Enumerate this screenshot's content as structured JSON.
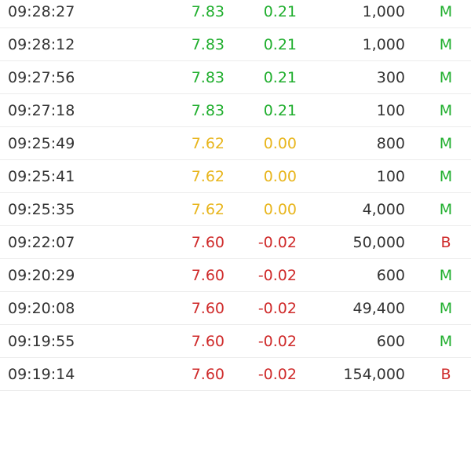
{
  "colors": {
    "up": "#1fae2d",
    "flat": "#e8b51c",
    "down": "#cf2a2a",
    "text": "#333333",
    "divider": "#ececec"
  },
  "trades": [
    {
      "time": "09:28:27",
      "price": "7.83",
      "change": "0.21",
      "volume": "1,000",
      "side": "M",
      "trend": "up",
      "side_type": "up"
    },
    {
      "time": "09:28:12",
      "price": "7.83",
      "change": "0.21",
      "volume": "1,000",
      "side": "M",
      "trend": "up",
      "side_type": "up"
    },
    {
      "time": "09:27:56",
      "price": "7.83",
      "change": "0.21",
      "volume": "300",
      "side": "M",
      "trend": "up",
      "side_type": "up"
    },
    {
      "time": "09:27:18",
      "price": "7.83",
      "change": "0.21",
      "volume": "100",
      "side": "M",
      "trend": "up",
      "side_type": "up"
    },
    {
      "time": "09:25:49",
      "price": "7.62",
      "change": "0.00",
      "volume": "800",
      "side": "M",
      "trend": "flat",
      "side_type": "up"
    },
    {
      "time": "09:25:41",
      "price": "7.62",
      "change": "0.00",
      "volume": "100",
      "side": "M",
      "trend": "flat",
      "side_type": "up"
    },
    {
      "time": "09:25:35",
      "price": "7.62",
      "change": "0.00",
      "volume": "4,000",
      "side": "M",
      "trend": "flat",
      "side_type": "up"
    },
    {
      "time": "09:22:07",
      "price": "7.60",
      "change": "-0.02",
      "volume": "50,000",
      "side": "B",
      "trend": "down",
      "side_type": "down"
    },
    {
      "time": "09:20:29",
      "price": "7.60",
      "change": "-0.02",
      "volume": "600",
      "side": "M",
      "trend": "down",
      "side_type": "up"
    },
    {
      "time": "09:20:08",
      "price": "7.60",
      "change": "-0.02",
      "volume": "49,400",
      "side": "M",
      "trend": "down",
      "side_type": "up"
    },
    {
      "time": "09:19:55",
      "price": "7.60",
      "change": "-0.02",
      "volume": "600",
      "side": "M",
      "trend": "down",
      "side_type": "up"
    },
    {
      "time": "09:19:14",
      "price": "7.60",
      "change": "-0.02",
      "volume": "154,000",
      "side": "B",
      "trend": "down",
      "side_type": "down"
    }
  ]
}
